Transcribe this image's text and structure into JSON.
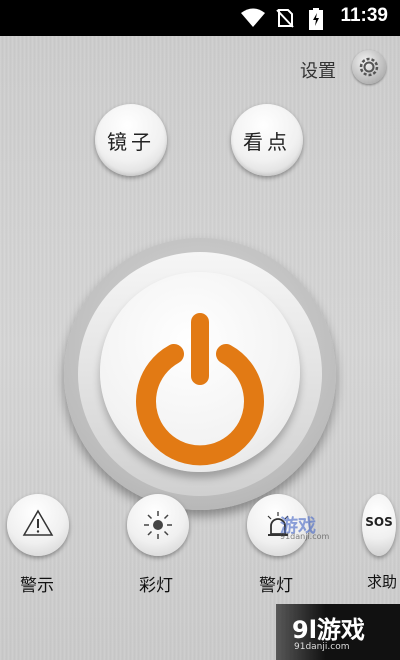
{
  "status": {
    "time": "11:39"
  },
  "header": {
    "settings_label": "设置"
  },
  "top_buttons": {
    "mirror": "镜子",
    "view": "看点"
  },
  "bottom": {
    "warning": "警示",
    "color_light": "彩灯",
    "alarm_light": "警灯",
    "sos_icon_text": "SOS",
    "sos_label": "求助"
  },
  "watermark": {
    "title": "游戏",
    "logo": "9l游戏",
    "url": "91danji.com"
  },
  "colors": {
    "power_accent": "#f08a1e",
    "background": "#d0d0d0"
  }
}
